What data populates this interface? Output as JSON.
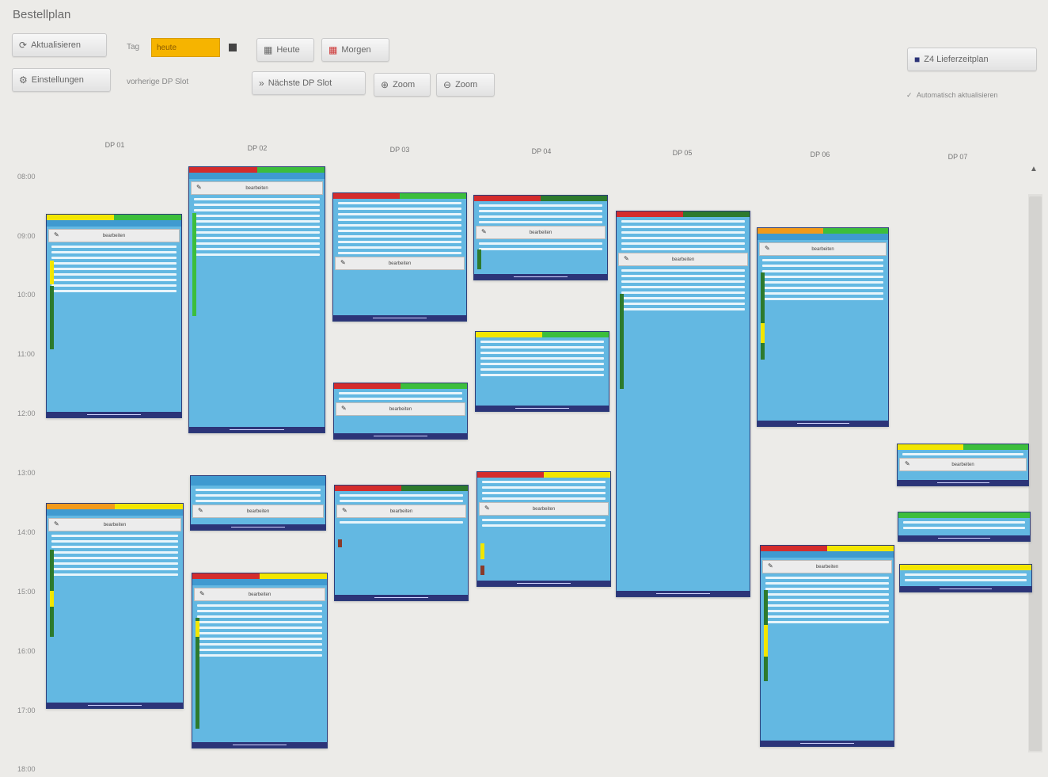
{
  "header": {
    "title": "Bestellplan"
  },
  "toolbar": {
    "refresh_label": "Aktualisieren",
    "settings_label": "Einstellungen",
    "day_label": "Tag",
    "date_value": "heute",
    "today_label": "Heute",
    "tomorrow_label": "Morgen",
    "prev_label": "vorherige DP Slot",
    "next_label": "Nächste DP Slot",
    "zoom_in_label": "Zoom",
    "zoom_out_label": "Zoom",
    "export_label": "Z4 Lieferzeitplan",
    "auto_label": "Automatisch aktualisieren"
  },
  "columns": [
    "DP 01",
    "DP 02",
    "DP 03",
    "DP 04",
    "DP 05",
    "DP 06",
    "DP 07"
  ],
  "times": [
    "08:00",
    "09:00",
    "10:00",
    "11:00",
    "12:00",
    "13:00",
    "14:00",
    "15:00",
    "16:00",
    "17:00",
    "18:00"
  ],
  "order_button_label": "bearbeiten",
  "colors": {
    "bg": "#ecebe8",
    "card": "#63b8e2",
    "footer": "#2c3478",
    "red": "#d42c2c",
    "green": "#3cbe3c",
    "yellow": "#f2e600",
    "darkgreen": "#2d7a2d",
    "orange": "#f29a1a"
  }
}
